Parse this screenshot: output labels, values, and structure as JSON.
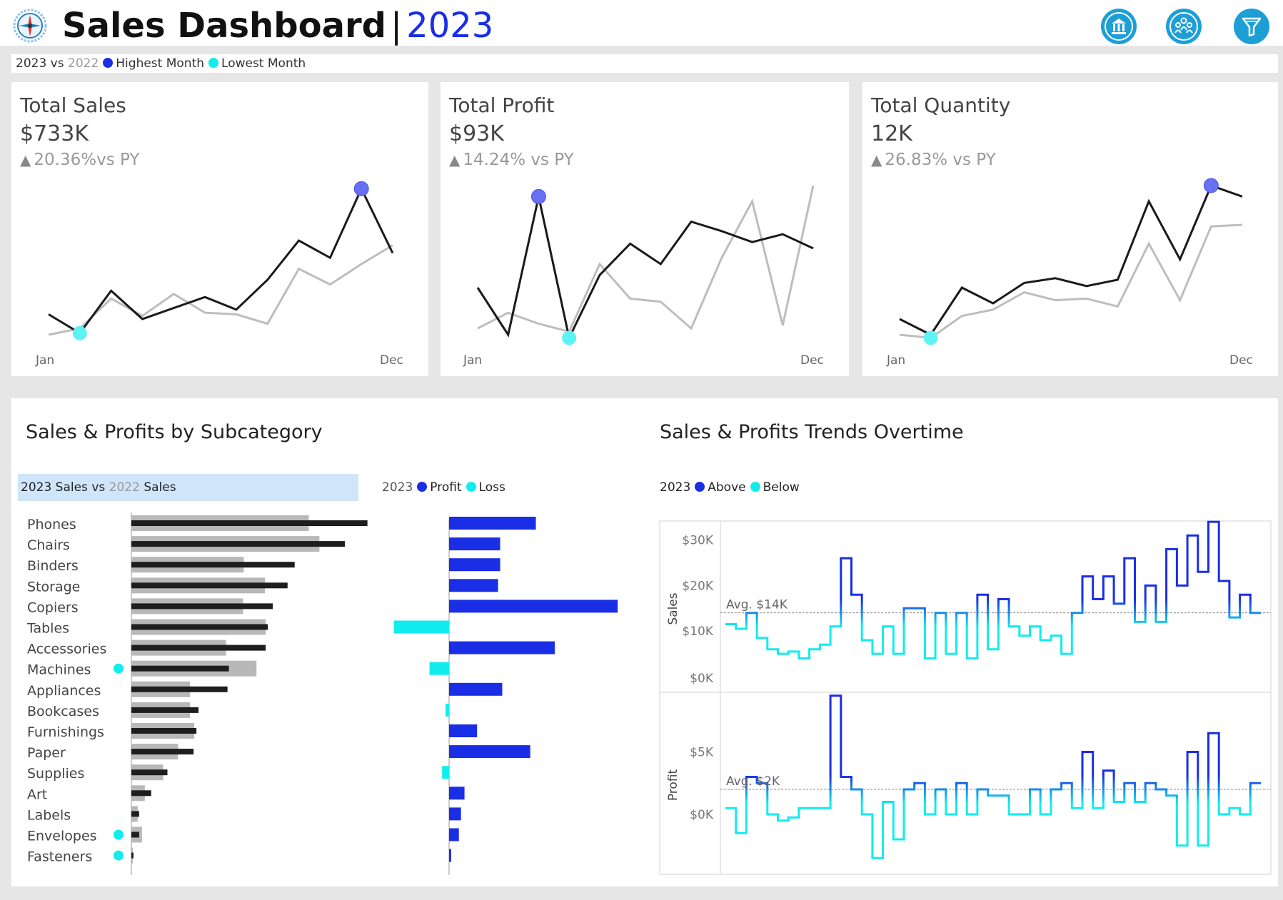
{
  "header": {
    "title": "Sales Dashboard",
    "separator": "|",
    "year": "2023",
    "logo_icon": "compass-icon",
    "buttons": [
      {
        "name": "bank-icon"
      },
      {
        "name": "people-icon"
      },
      {
        "name": "filter-icon"
      }
    ]
  },
  "legend": {
    "current": "2023",
    "vs": "vs",
    "previous": "2022",
    "highest": "Highest Month",
    "lowest": "Lowest Month"
  },
  "colors": {
    "accent_blue": "#1a2ee6",
    "cyan": "#12ecec",
    "line_current": "#1a1a1a",
    "line_previous": "#bdbdbd",
    "button_blue": "#1d9fd6"
  },
  "kpis": [
    {
      "title": "Total Sales",
      "value": "$733K",
      "change": "20.36%vs PY",
      "start": "Jan",
      "end": "Dec"
    },
    {
      "title": "Total Profit",
      "value": "$93K",
      "change": "14.24% vs PY",
      "start": "Jan",
      "end": "Dec"
    },
    {
      "title": "Total Quantity",
      "value": "12K",
      "change": "26.83%  vs PY",
      "start": "Jan",
      "end": "Dec"
    }
  ],
  "subcategory": {
    "title": "Sales & Profits by Subcategory",
    "sales_legend": {
      "current": "2023 Sales",
      "vs": "vs",
      "previous": "2022",
      "previous_suffix": "Sales"
    },
    "profit_legend": {
      "year": "2023",
      "profit": "Profit",
      "loss": "Loss"
    }
  },
  "trends": {
    "title": "Sales & Profits Trends Overtime",
    "legend": {
      "year": "2023",
      "above": "Above",
      "below": "Below"
    }
  },
  "chart_data": [
    {
      "type": "line",
      "title": "Total Sales",
      "x": [
        1,
        2,
        3,
        4,
        5,
        6,
        7,
        8,
        9,
        10,
        11,
        12
      ],
      "series": [
        {
          "values": [
            18,
            6,
            33,
            15,
            22,
            29,
            21,
            40,
            65,
            54,
            98,
            57
          ]
        },
        {
          "values": [
            5,
            9,
            28,
            17,
            31,
            19,
            18,
            12,
            47,
            37,
            50,
            62
          ]
        }
      ],
      "highest_month": 11,
      "lowest_month": 2
    },
    {
      "type": "line",
      "title": "Total Profit",
      "x": [
        1,
        2,
        3,
        4,
        5,
        6,
        7,
        8,
        9,
        10,
        11,
        12
      ],
      "series": [
        {
          "values": [
            35,
            5,
            93,
            3,
            43,
            63,
            50,
            77,
            71,
            64,
            69,
            60
          ]
        },
        {
          "values": [
            9,
            19,
            12,
            7,
            50,
            28,
            26,
            9,
            54,
            90,
            11,
            100
          ]
        }
      ],
      "highest_month": 3,
      "lowest_month": 4
    },
    {
      "type": "line",
      "title": "Total Quantity",
      "x": [
        1,
        2,
        3,
        4,
        5,
        6,
        7,
        8,
        9,
        10,
        11,
        12
      ],
      "series": [
        {
          "values": [
            15,
            5,
            35,
            25,
            38,
            41,
            36,
            40,
            90,
            53,
            100,
            93
          ]
        },
        {
          "values": [
            5,
            3,
            17,
            21,
            32,
            27,
            28,
            23,
            63,
            27,
            74,
            75
          ]
        }
      ],
      "highest_month": 11,
      "lowest_month": 2
    },
    {
      "type": "bar",
      "title": "Sales & Profits by Subcategory",
      "categories": [
        "Phones",
        "Chairs",
        "Binders",
        "Storage",
        "Copiers",
        "Tables",
        "Accessories",
        "Machines",
        "Appliances",
        "Bookcases",
        "Furnishings",
        "Paper",
        "Supplies",
        "Art",
        "Labels",
        "Envelopes",
        "Fasteners"
      ],
      "lowest_markers": [
        "Machines",
        "Envelopes",
        "Fasteners"
      ],
      "series": [
        {
          "name": "2023 Sales",
          "values": [
            334,
            302,
            231,
            221,
            200,
            193,
            190,
            138,
            136,
            95,
            92,
            88,
            51,
            28,
            11,
            11,
            3
          ]
        },
        {
          "name": "2022",
          "values": [
            251,
            266,
            159,
            189,
            158,
            190,
            134,
            177,
            83,
            83,
            89,
            66,
            45,
            19,
            9,
            15,
            2
          ]
        },
        {
          "name": "Profit",
          "values": [
            124,
            73,
            73,
            70,
            241,
            -79,
            151,
            -28,
            76,
            -5,
            40,
            116,
            -10,
            22,
            17,
            14,
            3
          ]
        }
      ]
    },
    {
      "type": "line",
      "title": "Sales & Profits Trends Overtime",
      "x": [
        1,
        2,
        3,
        4,
        5,
        6,
        7,
        8,
        9,
        10,
        11,
        12,
        13,
        14,
        15,
        16,
        17,
        18,
        19,
        20,
        21,
        22,
        23,
        24,
        25,
        26,
        27,
        28,
        29,
        30,
        31,
        32,
        33,
        34,
        35,
        36,
        37,
        38,
        39,
        40,
        41,
        42,
        43,
        44,
        45,
        46,
        47,
        48
      ],
      "series": [
        {
          "name": "Sales",
          "values": [
            11.5,
            10.5,
            14,
            8.5,
            6,
            5,
            5.5,
            4,
            6,
            7,
            11,
            26,
            18,
            8,
            5,
            11,
            5,
            15,
            15,
            4,
            14,
            5,
            14,
            4,
            18,
            6,
            17,
            11,
            9,
            11,
            8,
            9,
            5,
            14,
            22,
            17,
            22,
            16,
            26,
            12,
            20,
            12,
            28,
            20,
            31,
            23,
            34,
            21,
            13,
            18,
            14
          ]
        },
        {
          "name": "Profit",
          "values": [
            0.5,
            -1.5,
            3,
            2.5,
            0,
            -0.5,
            -0.25,
            0.5,
            0.5,
            0.5,
            9.5,
            3,
            2,
            0,
            -3.5,
            1,
            -2,
            2,
            2.5,
            0,
            2,
            0,
            2.5,
            0,
            2,
            1.5,
            1.5,
            0,
            0,
            2,
            0,
            2,
            2.5,
            0.5,
            5,
            0.5,
            3.5,
            1,
            2.5,
            1,
            2.5,
            2,
            1.5,
            -2.5,
            5,
            -2.5,
            6.5,
            0,
            0.5,
            0,
            2.5
          ]
        }
      ],
      "sales_axis": {
        "label": "Sales",
        "ticks": [
          "$0K",
          "$10K",
          "$20K",
          "$30K"
        ],
        "avg_label": "Avg. $14K",
        "avg": 14
      },
      "profit_axis": {
        "label": "Profit",
        "ticks": [
          "$0K",
          "$5K"
        ],
        "avg_label": "Avg. $2K",
        "avg": 2
      }
    }
  ]
}
